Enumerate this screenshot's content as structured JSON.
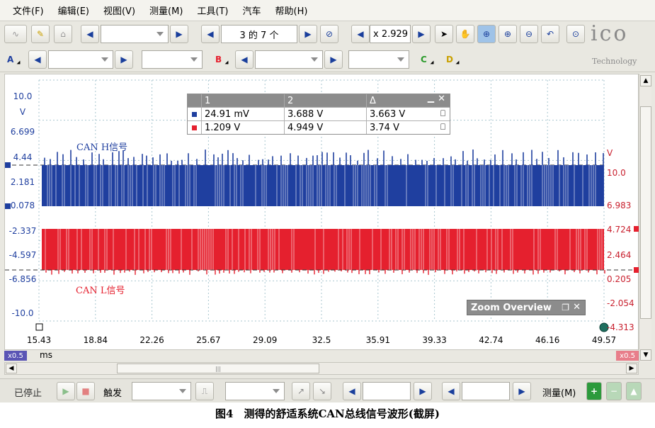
{
  "menu": [
    "文件(F)",
    "编辑(E)",
    "视图(V)",
    "测量(M)",
    "工具(T)",
    "汽车",
    "帮助(H)"
  ],
  "toolbar": {
    "buffer_label": "3 的 7 个",
    "zoom_label": "x 2.929",
    "logo_text": "ico",
    "logo_sub": "Technology"
  },
  "channels": [
    "A",
    "B",
    "C",
    "D"
  ],
  "plot": {
    "left_axis": [
      "10.0",
      "V",
      "6.699",
      "4.44",
      "2.181",
      "0.078",
      "-2.337",
      "-4.597",
      "-6.856",
      "-10.0"
    ],
    "right_axis": [
      "V",
      "10.0",
      "6.983",
      "4.724",
      "2.464",
      "0.205",
      "-2.054",
      "-4.313"
    ],
    "x_axis": [
      "15.43",
      "18.84",
      "22.26",
      "25.67",
      "29.09",
      "32.5",
      "35.91",
      "39.33",
      "42.74",
      "46.16",
      "49.57"
    ],
    "x_unit": "ms",
    "x_badge_left": "x0.5",
    "x_badge_right": "x0.5",
    "label_h": "CAN  H信号",
    "label_l": "CAN  L信号",
    "color_h": "#1f3f9f",
    "color_l": "#e5202e"
  },
  "measurements": {
    "headers": [
      "1",
      "2",
      "Δ"
    ],
    "rows": [
      {
        "color": "#1f3f9f",
        "v1": "24.91 mV",
        "v2": "3.688 V",
        "delta": "3.663 V"
      },
      {
        "color": "#e5202e",
        "v1": "1.209 V",
        "v2": "4.949 V",
        "delta": "3.74 V"
      }
    ]
  },
  "zoom_overview": {
    "title": "Zoom Overview"
  },
  "status": {
    "stopped": "已停止",
    "trigger": "触发",
    "measure": "测量(M)"
  },
  "caption": "图4　测得的舒适系统CAN总线信号波形(截屏)"
}
